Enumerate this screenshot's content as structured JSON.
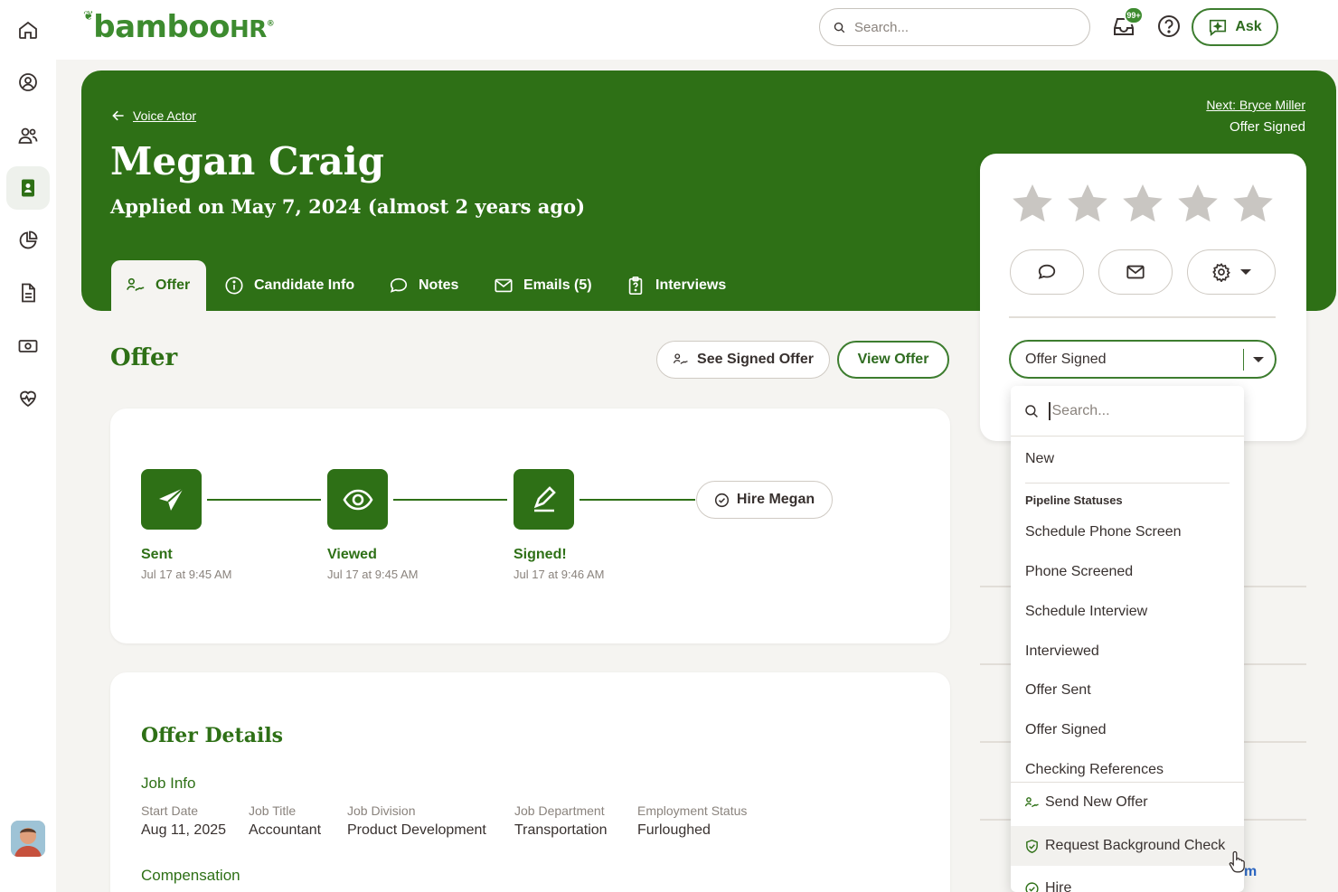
{
  "app": {
    "logo_text": "bamboo",
    "logo_suffix": "HR",
    "logo_mark": "®"
  },
  "topbar": {
    "search_placeholder": "Search...",
    "notification_badge": "99+",
    "ask_label": "Ask"
  },
  "rail": {
    "items": [
      "home-icon",
      "profile-icon",
      "people-icon",
      "hiring-icon",
      "reports-icon",
      "documents-icon",
      "payroll-icon",
      "benefits-icon"
    ],
    "active_index": 3
  },
  "header": {
    "back_label": "Voice Actor",
    "candidate_name": "Megan Craig",
    "applied_text": "Applied on May 7, 2024 (almost 2 years ago)",
    "next_label": "Next: Bryce Miller",
    "next_status": "Offer Signed"
  },
  "tabs": [
    {
      "label": "Offer",
      "icon": "signature-icon",
      "active": true
    },
    {
      "label": "Candidate Info",
      "icon": "info-icon",
      "active": false
    },
    {
      "label": "Notes",
      "icon": "chat-icon",
      "active": false
    },
    {
      "label": "Emails (5)",
      "icon": "mail-icon",
      "active": false
    },
    {
      "label": "Interviews",
      "icon": "clipboard-icon",
      "active": false
    }
  ],
  "offer": {
    "title": "Offer",
    "see_signed_label": "See Signed Offer",
    "view_offer_label": "View Offer",
    "steps": [
      {
        "label": "Sent",
        "date": "Jul 17 at 9:45 AM",
        "icon": "paper-plane-icon"
      },
      {
        "label": "Viewed",
        "date": "Jul 17 at 9:45 AM",
        "icon": "eye-icon"
      },
      {
        "label": "Signed!",
        "date": "Jul 17 at 9:46 AM",
        "icon": "pen-icon"
      }
    ],
    "hire_label": "Hire Megan"
  },
  "details": {
    "title": "Offer Details",
    "job_info_label": "Job Info",
    "fields": [
      {
        "key": "Start Date",
        "value": "Aug 11, 2025"
      },
      {
        "key": "Job Title",
        "value": "Accountant"
      },
      {
        "key": "Job Division",
        "value": "Product Development"
      },
      {
        "key": "Job Department",
        "value": "Transportation"
      },
      {
        "key": "Employment Status",
        "value": "Furloughed"
      }
    ],
    "compensation_label": "Compensation"
  },
  "side": {
    "rating": {
      "value": 0,
      "max": 5
    },
    "status_value": "Offer Signed",
    "link_fragment": "m"
  },
  "dropdown": {
    "search_placeholder": "Search...",
    "top_item": "New",
    "group_label": "Pipeline Statuses",
    "items": [
      "Schedule Phone Screen",
      "Phone Screened",
      "Schedule Interview",
      "Interviewed",
      "Offer Sent",
      "Offer Signed",
      "Checking References"
    ],
    "actions": [
      "Send New Offer",
      "Request Background Check",
      "Hire"
    ]
  },
  "colors": {
    "brand_green": "#2e7016",
    "accent_green": "#3d8b2f",
    "page_bg": "#f5f4f1",
    "star_gray": "#c9c6c2"
  }
}
